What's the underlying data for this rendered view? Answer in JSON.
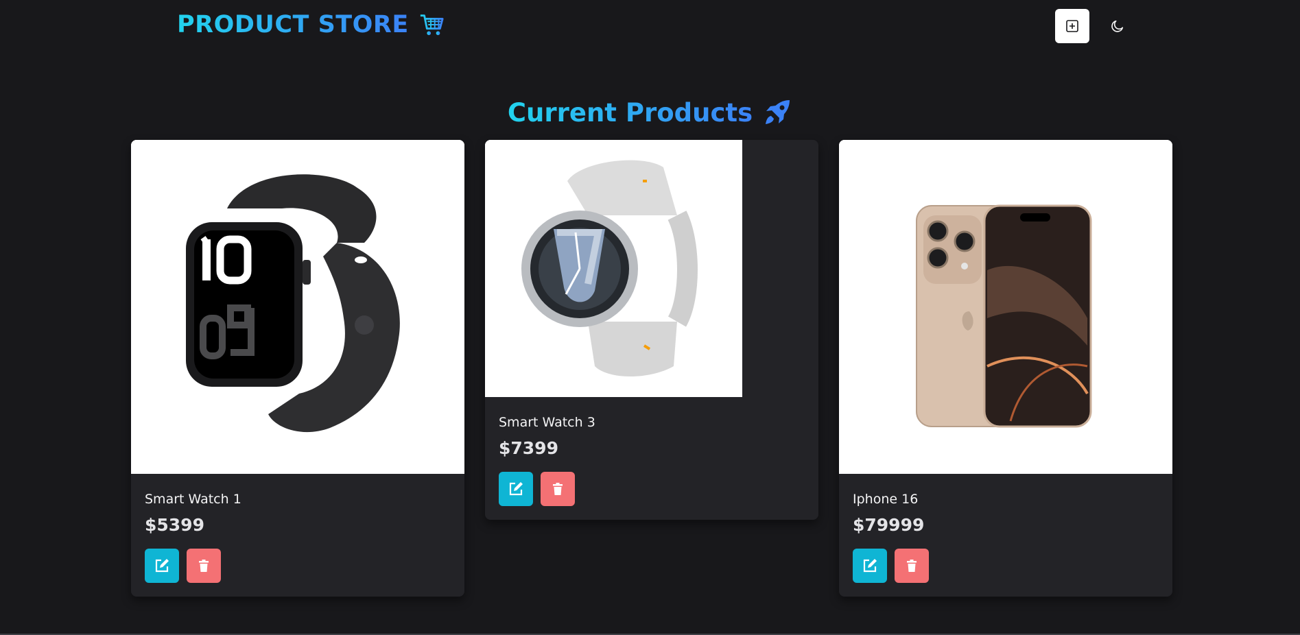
{
  "navbar": {
    "brand": "PRODUCT STORE",
    "brand_icon": "shopping-cart-icon",
    "create_icon": "plus-square-icon",
    "mode_icon": "moon-icon"
  },
  "heading": {
    "title": "Current Products",
    "icon": "rocket-icon"
  },
  "colors": {
    "background": "#18181b",
    "card": "#232327",
    "accent_gradient_start": "#22d3ee",
    "accent_gradient_end": "#3b82f6",
    "edit_button": "#0fb5d4",
    "delete_button": "#f47174"
  },
  "products": [
    {
      "name": "Smart Watch 1",
      "price": "$5399",
      "image": "black-smart-watch-image"
    },
    {
      "name": "Smart Watch 3",
      "price": "$7399",
      "image": "silver-smart-watch-image"
    },
    {
      "name": "Iphone 16",
      "price": "$79999",
      "image": "gold-iphone-image"
    }
  ],
  "actions": {
    "edit_icon": "edit-icon",
    "delete_icon": "trash-icon"
  }
}
